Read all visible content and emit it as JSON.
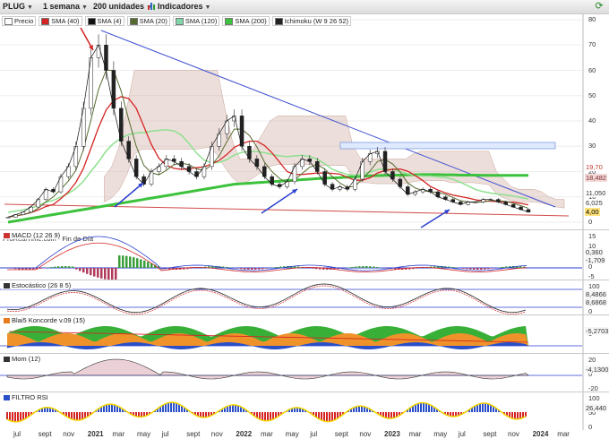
{
  "toolbar": {
    "ticker": "PLUG",
    "period": "1 semana",
    "units": "200 unidades",
    "indicators": "Indicadores"
  },
  "legend": [
    {
      "label": "Precio",
      "color": "#ffffff"
    },
    {
      "label": "SMA (40)",
      "color": "#d42424"
    },
    {
      "label": "SMA (4)",
      "color": "#111111"
    },
    {
      "label": "SMA (20)",
      "color": "#556b2f"
    },
    {
      "label": "SMA (120)",
      "color": "#7fd6a8"
    },
    {
      "label": "SMA (200)",
      "color": "#3cc23c"
    },
    {
      "label": "Ichimoku (W 9 26 52)",
      "color": "#222222"
    }
  ],
  "source": "ProRealTime.com - Fin de Día",
  "price_axis": [
    "80",
    "70",
    "60",
    "50",
    "40",
    "30",
    "20",
    "10",
    "0"
  ],
  "price_badges": [
    {
      "text": "19,70",
      "bg": "#ffffff",
      "fg": "#c0392b"
    },
    {
      "text": "18,482",
      "bg": "#f3d9d9",
      "fg": "#7a2a2a"
    },
    {
      "text": "11,050",
      "bg": "#ffffff",
      "fg": "#333333"
    },
    {
      "text": "6,025",
      "bg": "#ffffff",
      "fg": "#333333"
    },
    {
      "text": "4,00",
      "bg": "#ffe27a",
      "fg": "#000000"
    }
  ],
  "panes": {
    "macd": {
      "title": "MACD (12 26 9)",
      "axis": [
        "15",
        "10",
        "5",
        "0",
        "-5"
      ],
      "badges": [
        "0,360",
        "-1,709"
      ]
    },
    "stoch": {
      "title": "Estocástico (26 8 5)",
      "axis": [
        "100",
        "50",
        "0"
      ],
      "badges": [
        "8,4866",
        "8,6868"
      ]
    },
    "koncorde": {
      "title": "Blai5 Koncorde v.09 (15)",
      "axis": [
        "0"
      ],
      "badges": [
        "-5,2703"
      ]
    },
    "mom": {
      "title": "Mom (12)",
      "axis": [
        "20",
        "0",
        "-20"
      ],
      "badges": [
        "-4,1300"
      ]
    },
    "rsi": {
      "title": "FILTRO RSI",
      "axis": [
        "100",
        "50",
        "0"
      ],
      "badges": [
        "26,440"
      ]
    }
  },
  "x_axis": [
    "jul",
    "sept",
    "nov",
    "2021",
    "mar",
    "may",
    "jul",
    "sept",
    "nov",
    "2022",
    "mar",
    "may",
    "jul",
    "sept",
    "nov",
    "2023",
    "mar",
    "may",
    "jul",
    "sept",
    "nov",
    "2024",
    "mar"
  ],
  "chart_data": {
    "type": "line",
    "title": "",
    "ticker": "PLUG",
    "period": "1 semana",
    "price_range": [
      0,
      80
    ],
    "close": [
      2,
      3,
      4,
      6,
      9,
      13,
      12,
      18,
      22,
      30,
      45,
      65,
      70,
      60,
      45,
      32,
      25,
      18,
      15,
      20,
      22,
      25,
      24,
      22,
      20,
      18,
      22,
      30,
      35,
      40,
      42,
      30,
      25,
      22,
      18,
      15,
      14,
      16,
      22,
      25,
      24,
      20,
      15,
      13,
      14,
      13,
      17,
      24,
      27,
      28,
      20,
      17,
      14,
      11,
      12,
      13,
      12,
      10,
      9,
      8,
      7,
      8,
      8,
      9,
      9,
      8,
      7,
      6,
      5,
      4
    ],
    "sma200": [
      0,
      0.5,
      1,
      1.5,
      2,
      2.5,
      3,
      3.5,
      4,
      4.5,
      5,
      5.5,
      6,
      6.5,
      7,
      7.5,
      8,
      8.5,
      9,
      9.5,
      10,
      10.5,
      11,
      11.5,
      12,
      12.5,
      13,
      13.5,
      14,
      14.5,
      15,
      15.2,
      15.4,
      15.6,
      15.8,
      16,
      16.2,
      16.4,
      16.6,
      16.8,
      17,
      17.2,
      17.4,
      17.5,
      17.6,
      17.8,
      18,
      18.2,
      18.3,
      18.4,
      18.5,
      18.6,
      18.6,
      18.7,
      18.7,
      18.8,
      18.8,
      18.8,
      18.7,
      18.7,
      18.6,
      18.6,
      18.6,
      18.5,
      18.5,
      18.5,
      18.5,
      18.5,
      18.5,
      18.5
    ],
    "x_labels": [
      "jul",
      "sept",
      "nov",
      "2021",
      "mar",
      "may",
      "jul",
      "sept",
      "nov",
      "2022",
      "mar",
      "may",
      "jul",
      "sept",
      "nov",
      "2023",
      "mar",
      "may",
      "jul",
      "sept",
      "nov",
      "2024",
      "mar"
    ]
  }
}
